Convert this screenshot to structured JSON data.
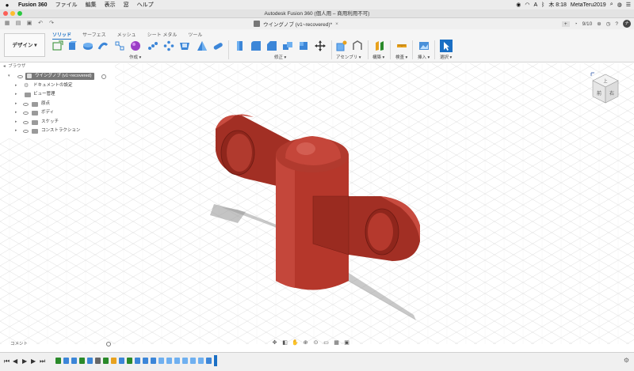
{
  "menubar": {
    "app_name": "Fusion 360",
    "items": [
      "ファイル",
      "編集",
      "表示",
      "窓",
      "ヘルプ"
    ],
    "clock": "木 8:18",
    "user": "MetaTeru2019"
  },
  "window": {
    "title": "Autodesk Fusion 360 (個人用 – 商用利用不可)"
  },
  "quick_access": {
    "doc_tab_label": "ウイングノブ (v1~recovered)*",
    "job_status": "9/10",
    "user_initials": "ナテ"
  },
  "ribbon": {
    "workspace_label": "デザイン ▾",
    "tabs": [
      "ソリッド",
      "サーフェス",
      "メッシュ",
      "シート メタル",
      "ツール"
    ],
    "active_tab": "ソリッド",
    "groups": {
      "create": "作成 ▾",
      "modify": "修正 ▾",
      "assemble": "アセンブリ ▾",
      "construct": "構築 ▾",
      "inspect": "検査 ▾",
      "insert": "挿入 ▾",
      "select": "選択 ▾"
    },
    "accent_color": "#1a6fc4"
  },
  "browser": {
    "title": "ブラウザ",
    "root_label": "ウイングノブ (v1~recovered)",
    "items": [
      {
        "label": "ドキュメントの設定",
        "icon": "gear-icon"
      },
      {
        "label": "ビュー管理",
        "icon": "folder-icon"
      },
      {
        "label": "原点",
        "icon": "folder-icon"
      },
      {
        "label": "ボディ",
        "icon": "folder-icon"
      },
      {
        "label": "スケッチ",
        "icon": "folder-icon"
      },
      {
        "label": "コンストラクション",
        "icon": "folder-icon"
      }
    ]
  },
  "viewcube": {
    "face_top": "上",
    "face_front": "前",
    "face_right": "右"
  },
  "comments": {
    "label": "コメント"
  },
  "model": {
    "body_color": "#b5372b",
    "shadow_color": "#9c9c9c"
  }
}
